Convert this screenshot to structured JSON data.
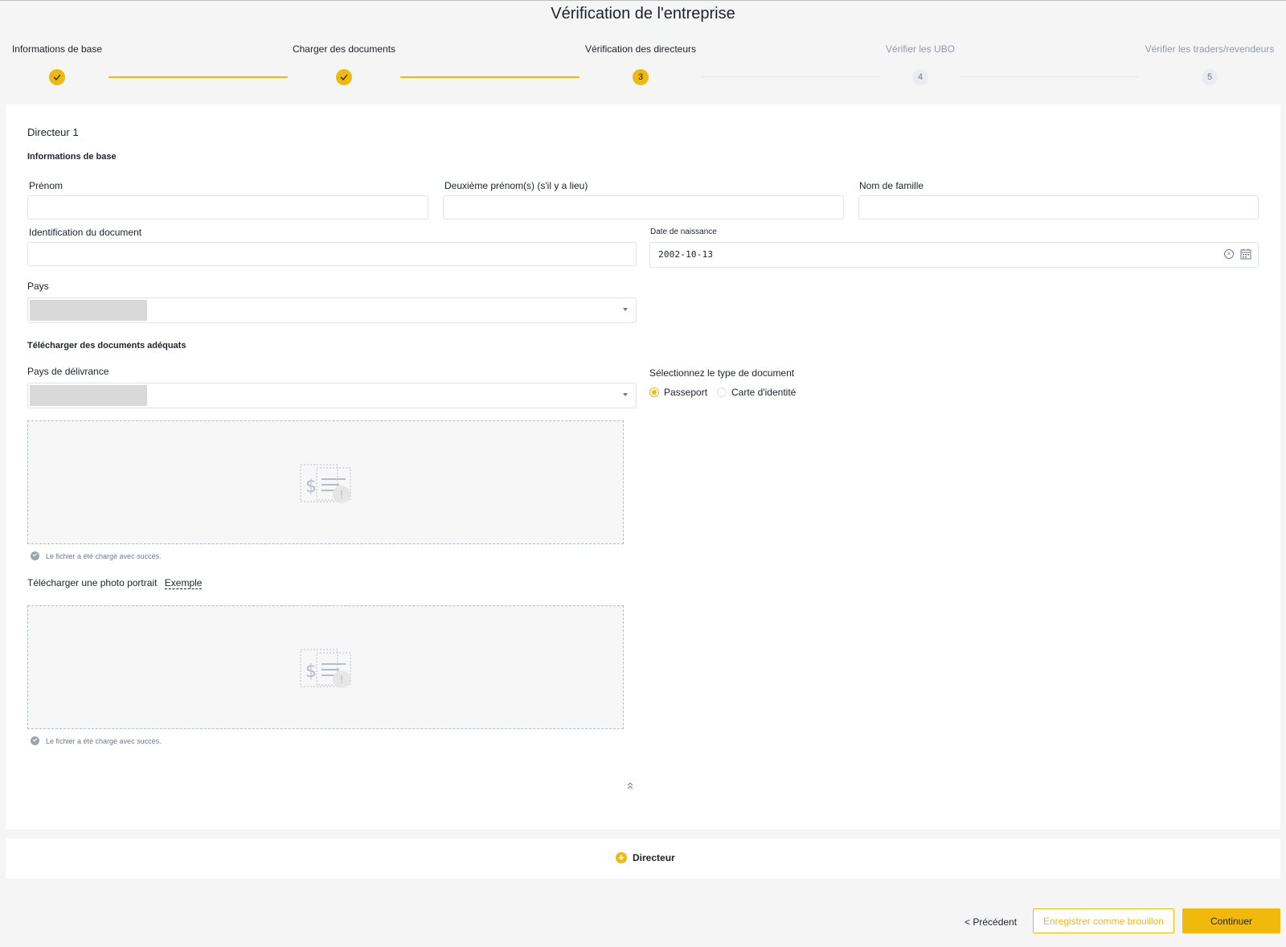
{
  "page": {
    "title": "Vérification de l'entreprise"
  },
  "stepper": {
    "steps": [
      {
        "label": "Informations de base",
        "status": "done",
        "number": ""
      },
      {
        "label": "Charger des documents",
        "status": "done",
        "number": ""
      },
      {
        "label": "Vérification des directeurs",
        "status": "active",
        "number": "3"
      },
      {
        "label": "Vérifier les UBO",
        "status": "todo",
        "number": "4"
      },
      {
        "label": "Vérifier les traders/revendeurs",
        "status": "todo",
        "number": "5"
      }
    ]
  },
  "director": {
    "heading": "Directeur 1",
    "basic_info_title": "Informations de base",
    "first_name": {
      "label": "Prénom",
      "value": ""
    },
    "middle_name": {
      "label": "Deuxième prénom(s) (s'il y a lieu)",
      "value": ""
    },
    "last_name": {
      "label": "Nom de famille",
      "value": ""
    },
    "document_id": {
      "label": "Identification du document",
      "value": ""
    },
    "birth_date": {
      "label": "Date de naissance",
      "value": "2002-10-13"
    },
    "country": {
      "label": "Pays"
    },
    "upload_title": "Télécharger des documents adéquats",
    "issuing_country": {
      "label": "Pays de délivrance"
    },
    "document_type": {
      "label": "Sélectionnez le type de document",
      "options": [
        {
          "label": "Passeport",
          "selected": true
        },
        {
          "label": "Carte d'identité",
          "selected": false
        }
      ]
    },
    "document_upload_status": "Le fichier a été chargé avec succès.",
    "portrait": {
      "label": "Télécharger une photo portrait",
      "example_link": "Exemple",
      "status": "Le fichier a été chargé avec succès."
    }
  },
  "add_director": {
    "label": "Directeur"
  },
  "footer": {
    "previous": "< Précédent",
    "save_draft": "Enregistrer comme brouillon",
    "continue": "Continuer"
  },
  "colors": {
    "accent": "#f0b90b",
    "text": "#1e2329",
    "muted": "#929aa5",
    "border": "#e0e3e7"
  }
}
